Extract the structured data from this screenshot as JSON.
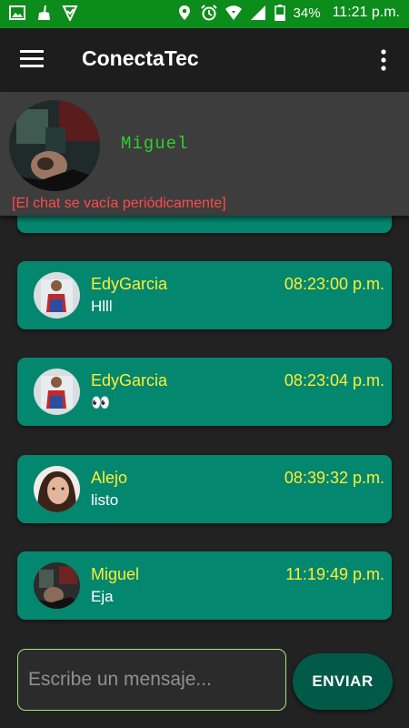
{
  "status_bar": {
    "battery_percent": "34%",
    "time": "11:21 p.m.",
    "icons": [
      "image-icon",
      "cleaner-icon",
      "vpn-check-icon",
      "location-icon",
      "alarm-icon",
      "wifi-icon",
      "signal-icon",
      "battery-icon"
    ]
  },
  "app_bar": {
    "title": "ConectaTec",
    "icons": [
      "menu-icon",
      "more-vert-icon"
    ]
  },
  "profile": {
    "name": "Miguel",
    "notice": "[El chat se vacía periódicamente]"
  },
  "messages": [
    {
      "user": "EdyGarcia",
      "time": "08:23:00 p.m.",
      "text": "Hlll"
    },
    {
      "user": "EdyGarcia",
      "time": "08:23:04 p.m.",
      "text": "👀"
    },
    {
      "user": "Alejo",
      "time": "08:39:32 p.m.",
      "text": "listo"
    },
    {
      "user": "Miguel",
      "time": "11:19:49 p.m.",
      "text": "Eja"
    }
  ],
  "composer": {
    "placeholder": "Escribe un mensaje...",
    "send_label": "ENVIAR"
  },
  "colors": {
    "status_bar": "#0c8c1a",
    "app_bar": "#1d1d1d",
    "card": "#03876f",
    "username": "#ffee33",
    "profile_name": "#2fcf2f",
    "notice": "#ff4a4a",
    "send_button": "#015a48",
    "input_border": "#a8e17d"
  }
}
